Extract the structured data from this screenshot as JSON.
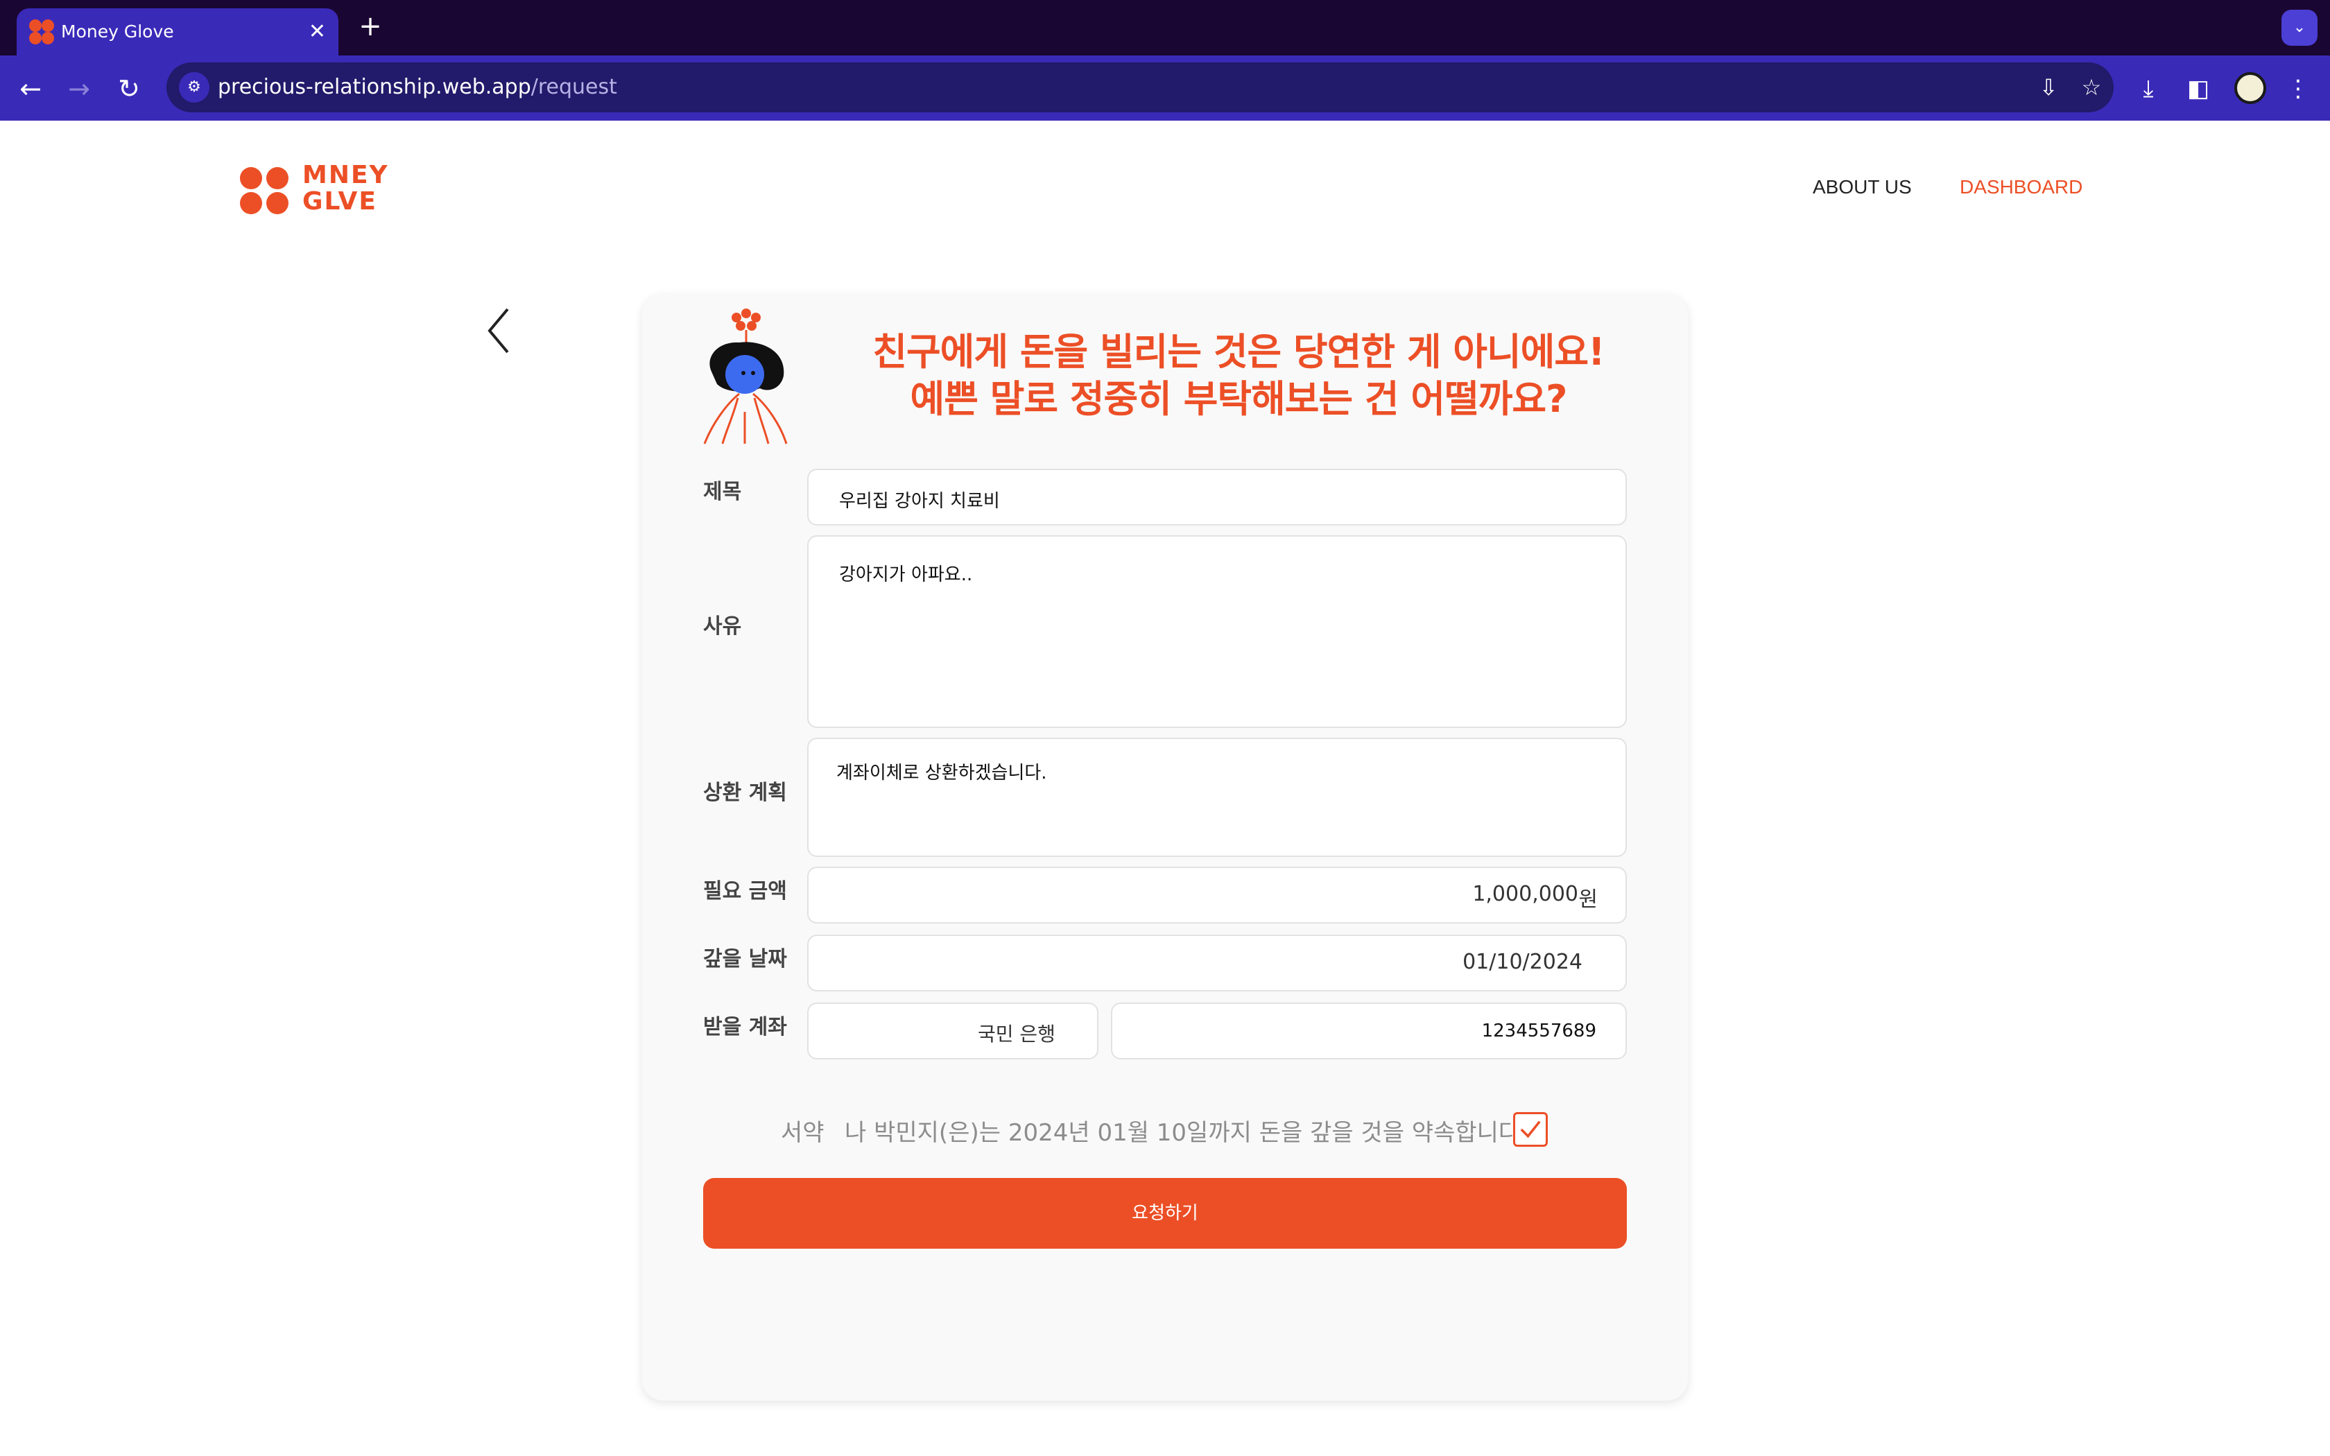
{
  "browser": {
    "tab_title": "Money Glove",
    "tab_close": "✕",
    "new_tab": "+",
    "url_host": "precious-relationship.web.app",
    "url_path": "/request"
  },
  "site": {
    "logo_line1": "MNEY",
    "logo_line2": "GLVE",
    "nav": [
      {
        "label": "ABOUT US"
      },
      {
        "label": "DASHBOARD"
      }
    ]
  },
  "form": {
    "headline_line1": "친구에게 돈을 빌리는 것은 당연한 게 아니에요!",
    "headline_line2": "예쁜 말로 정중히 부탁해보는 건 어떨까요?",
    "labels": {
      "title": "제목",
      "reason": "사유",
      "repay_plan": "상환 계획",
      "amount": "필요 금액",
      "due_date": "갚을 날짜",
      "account": "받을 계좌"
    },
    "values": {
      "title": "우리집 강아지 치료비",
      "reason": "강아지가 아파요..",
      "repay_plan": "계좌이체로 상환하겠습니다.",
      "amount": "1,000,000",
      "amount_unit": "원",
      "due_date": "01/10/2024",
      "bank": "국민 은행",
      "account_number": "1234557689"
    },
    "pledge_label": "서약",
    "pledge_text": "나 박민지(은)는 2024년 01월 10일까지 돈을 갚을 것을 약속합니다.",
    "pledge_checked": true,
    "submit_label": "요청하기"
  },
  "colors": {
    "brand": "#ec4f26",
    "chrome_dark": "#1a0632",
    "chrome_toolbar": "#3a2ab8"
  }
}
